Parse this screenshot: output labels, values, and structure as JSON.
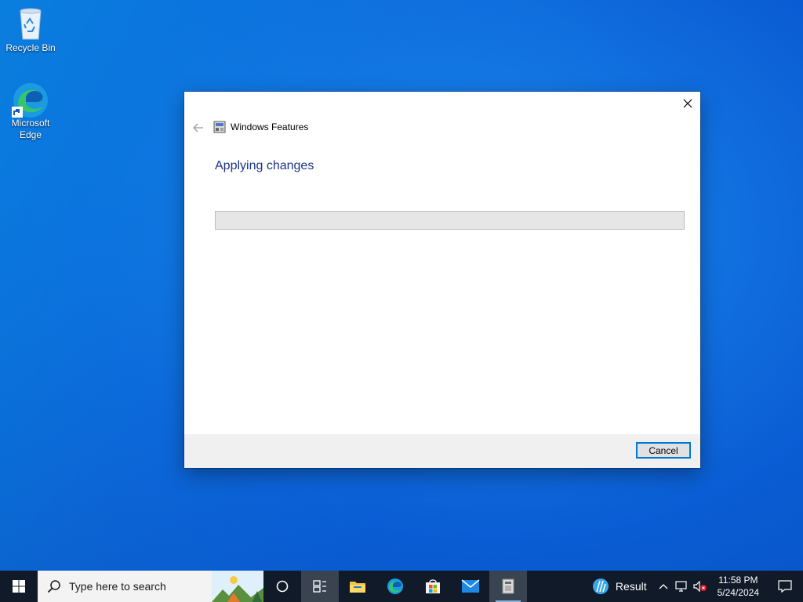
{
  "desktop": {
    "icons": [
      {
        "label": "Recycle Bin",
        "icon": "recycle-bin-icon"
      },
      {
        "label": "Microsoft Edge",
        "icon": "edge-icon"
      }
    ]
  },
  "dialog": {
    "window_title": "Windows Features",
    "heading": "Applying changes",
    "progress_percent": 0,
    "cancel_label": "Cancel",
    "close_icon": "close-icon",
    "back_icon": "back-arrow-icon"
  },
  "taskbar": {
    "search_placeholder": "Type here to search",
    "apps": [
      {
        "name": "cortana",
        "icon": "circle-icon"
      },
      {
        "name": "task-view",
        "icon": "task-view-icon"
      },
      {
        "name": "file-explorer",
        "icon": "folder-icon"
      },
      {
        "name": "edge",
        "icon": "edge-icon"
      },
      {
        "name": "store",
        "icon": "store-icon"
      },
      {
        "name": "mail",
        "icon": "mail-icon"
      },
      {
        "name": "windows-features",
        "icon": "windows-features-icon",
        "active": true
      }
    ],
    "weather_label": "Result",
    "time": "11:58 PM",
    "date": "5/24/2024"
  },
  "colors": {
    "accent": "#0078d7",
    "heading": "#1e3287",
    "taskbar": "#101a28"
  }
}
